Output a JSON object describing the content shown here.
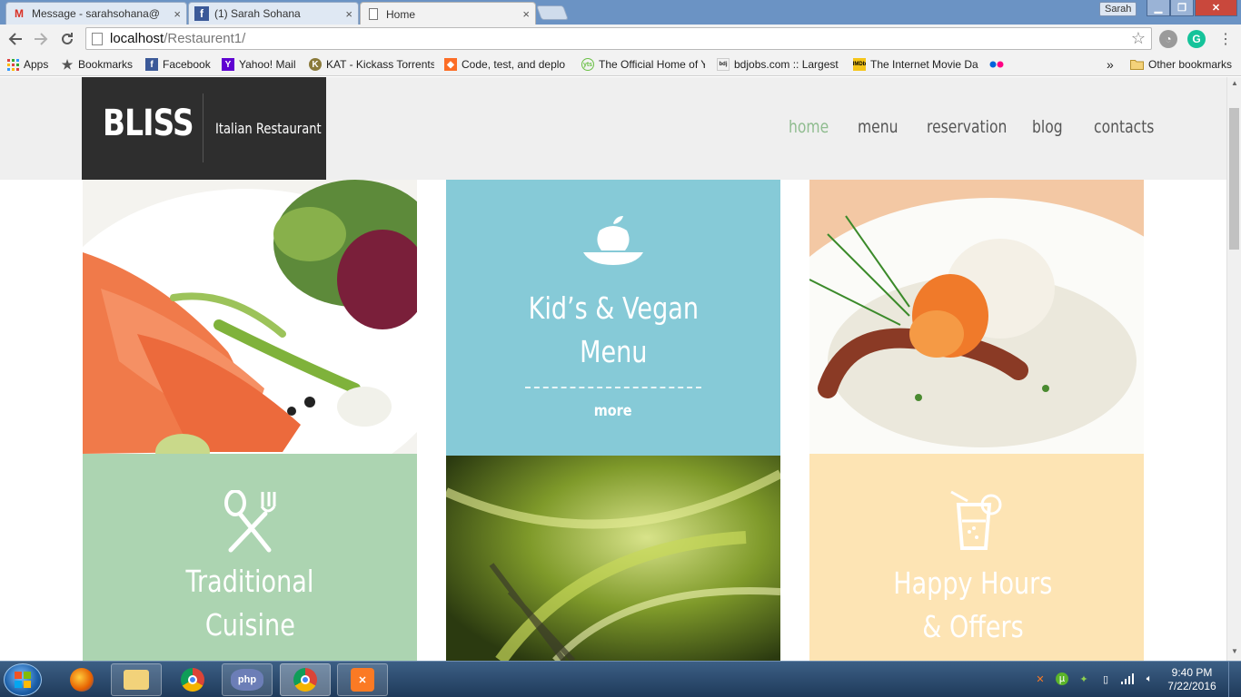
{
  "browser": {
    "tabs": [
      {
        "title": "Message - sarahsohana@",
        "icon": "gmail-icon"
      },
      {
        "title": "(1) Sarah Sohana",
        "icon": "facebook-icon"
      },
      {
        "title": "Home",
        "icon": "page-icon"
      }
    ],
    "close_glyph": "×",
    "user_label": "Sarah",
    "url_host": "localhost",
    "url_path": "/Restaurent1/",
    "bookmarks": [
      {
        "label": "Apps",
        "icon": "apps-grid-icon"
      },
      {
        "label": "Bookmarks",
        "icon": "star-icon"
      },
      {
        "label": "Facebook",
        "icon": "facebook-icon"
      },
      {
        "label": "Yahoo! Mail",
        "icon": "yahoo-icon"
      },
      {
        "label": "KAT - Kickass Torrents",
        "icon": "kat-icon"
      },
      {
        "label": "Code, test, and deplo",
        "icon": "gitlab-icon"
      },
      {
        "label": "The Official Home of Y",
        "icon": "yts-icon"
      },
      {
        "label": "bdjobs.com :: Largest",
        "icon": "bdjobs-icon"
      },
      {
        "label": "The Internet Movie Da",
        "icon": "imdb-icon"
      },
      {
        "label": "",
        "icon": "flickr-icon"
      }
    ],
    "overflow_glyph": "»",
    "other_bookmarks": "Other bookmarks"
  },
  "site": {
    "brand": "BLISS",
    "tagline": "Italian Restaurant",
    "nav": [
      "home",
      "menu",
      "reservation",
      "blog",
      "contacts"
    ],
    "active_nav": "home",
    "tiles": {
      "kids_vegan": {
        "line1": "Kid’s & Vegan",
        "line2": "Menu",
        "more": "more",
        "color": "#86cad7",
        "icon": "apple-bowl-icon"
      },
      "traditional": {
        "line1": "Traditional",
        "line2": "Cuisine",
        "color": "#acd4b1",
        "icon": "spoon-fork-icon"
      },
      "happy_hours": {
        "line1": "Happy Hours",
        "line2": "& Offers",
        "color": "#fde4b4",
        "icon": "cocktail-glass-icon"
      }
    },
    "photos": [
      "salmon-salad-photo",
      "shrimp-octopus-risotto-photo",
      "pasta-fork-photo"
    ]
  },
  "taskbar": {
    "apps": [
      "firefox-icon",
      "file-explorer-icon",
      "chrome-icon",
      "php-icon",
      "chrome-icon",
      "xampp-icon"
    ],
    "php_label": "php",
    "time": "9:40 PM",
    "date": "7/22/2016"
  }
}
